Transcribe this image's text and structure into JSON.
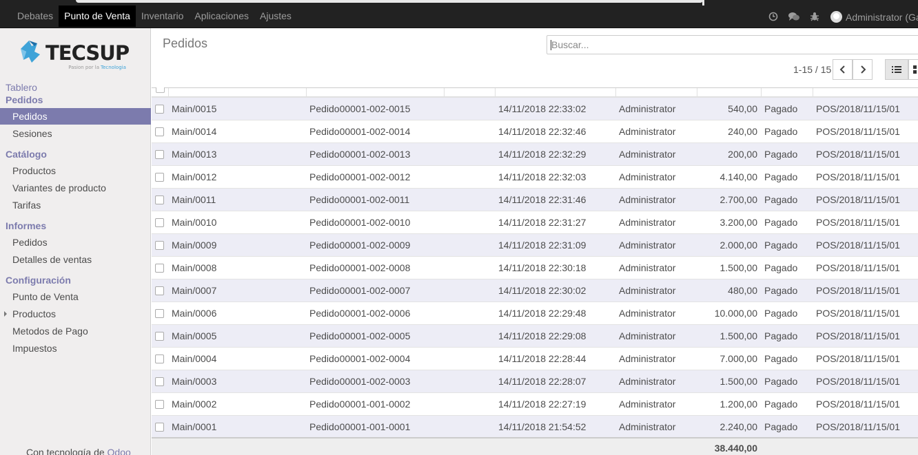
{
  "topbar": {
    "menu": [
      "Debates",
      "Punto de Venta",
      "Inventario",
      "Aplicaciones",
      "Ajustes"
    ],
    "user_label": "Administrator (Gab"
  },
  "sidebar": {
    "logo_text": "TECSUP",
    "logo_tagline_prefix": "Pasion por la",
    "logo_tagline_suffix": "Tecnologia",
    "tablero": "Tablero",
    "pedidos_header": "Pedidos",
    "pedidos_item": "Pedidos",
    "sesiones": "Sesiones",
    "catalogo": "Catálogo",
    "productos": "Productos",
    "variantes": "Variantes de producto",
    "tarifas": "Tarifas",
    "informes": "Informes",
    "inf_pedidos": "Pedidos",
    "detalles": "Detalles de ventas",
    "configuracion": "Configuración",
    "punto_venta": "Punto de Venta",
    "conf_productos": "Productos",
    "metodos": "Metodos de Pago",
    "impuestos": "Impuestos",
    "powered_prefix": "Con tecnología de",
    "powered_brand": "Odoo"
  },
  "control": {
    "title": "Pedidos",
    "search_placeholder": "Buscar...",
    "pager": "1-15 / 15"
  },
  "orders": [
    {
      "ref": "Main/0015",
      "order": "Pedido00001-002-0015",
      "date": "14/11/2018 22:33:02",
      "user": "Administrator",
      "amount": "540,00",
      "state": "Pagado",
      "session": "POS/2018/11/15/01"
    },
    {
      "ref": "Main/0014",
      "order": "Pedido00001-002-0014",
      "date": "14/11/2018 22:32:46",
      "user": "Administrator",
      "amount": "240,00",
      "state": "Pagado",
      "session": "POS/2018/11/15/01"
    },
    {
      "ref": "Main/0013",
      "order": "Pedido00001-002-0013",
      "date": "14/11/2018 22:32:29",
      "user": "Administrator",
      "amount": "200,00",
      "state": "Pagado",
      "session": "POS/2018/11/15/01"
    },
    {
      "ref": "Main/0012",
      "order": "Pedido00001-002-0012",
      "date": "14/11/2018 22:32:03",
      "user": "Administrator",
      "amount": "4.140,00",
      "state": "Pagado",
      "session": "POS/2018/11/15/01"
    },
    {
      "ref": "Main/0011",
      "order": "Pedido00001-002-0011",
      "date": "14/11/2018 22:31:46",
      "user": "Administrator",
      "amount": "2.700,00",
      "state": "Pagado",
      "session": "POS/2018/11/15/01"
    },
    {
      "ref": "Main/0010",
      "order": "Pedido00001-002-0010",
      "date": "14/11/2018 22:31:27",
      "user": "Administrator",
      "amount": "3.200,00",
      "state": "Pagado",
      "session": "POS/2018/11/15/01"
    },
    {
      "ref": "Main/0009",
      "order": "Pedido00001-002-0009",
      "date": "14/11/2018 22:31:09",
      "user": "Administrator",
      "amount": "2.000,00",
      "state": "Pagado",
      "session": "POS/2018/11/15/01"
    },
    {
      "ref": "Main/0008",
      "order": "Pedido00001-002-0008",
      "date": "14/11/2018 22:30:18",
      "user": "Administrator",
      "amount": "1.500,00",
      "state": "Pagado",
      "session": "POS/2018/11/15/01"
    },
    {
      "ref": "Main/0007",
      "order": "Pedido00001-002-0007",
      "date": "14/11/2018 22:30:02",
      "user": "Administrator",
      "amount": "480,00",
      "state": "Pagado",
      "session": "POS/2018/11/15/01"
    },
    {
      "ref": "Main/0006",
      "order": "Pedido00001-002-0006",
      "date": "14/11/2018 22:29:48",
      "user": "Administrator",
      "amount": "10.000,00",
      "state": "Pagado",
      "session": "POS/2018/11/15/01"
    },
    {
      "ref": "Main/0005",
      "order": "Pedido00001-002-0005",
      "date": "14/11/2018 22:29:08",
      "user": "Administrator",
      "amount": "1.500,00",
      "state": "Pagado",
      "session": "POS/2018/11/15/01"
    },
    {
      "ref": "Main/0004",
      "order": "Pedido00001-002-0004",
      "date": "14/11/2018 22:28:44",
      "user": "Administrator",
      "amount": "7.000,00",
      "state": "Pagado",
      "session": "POS/2018/11/15/01"
    },
    {
      "ref": "Main/0003",
      "order": "Pedido00001-002-0003",
      "date": "14/11/2018 22:28:07",
      "user": "Administrator",
      "amount": "1.500,00",
      "state": "Pagado",
      "session": "POS/2018/11/15/01"
    },
    {
      "ref": "Main/0002",
      "order": "Pedido00001-001-0002",
      "date": "14/11/2018 22:27:19",
      "user": "Administrator",
      "amount": "1.200,00",
      "state": "Pagado",
      "session": "POS/2018/11/15/01"
    },
    {
      "ref": "Main/0001",
      "order": "Pedido00001-001-0001",
      "date": "14/11/2018 21:54:52",
      "user": "Administrator",
      "amount": "2.240,00",
      "state": "Pagado",
      "session": "POS/2018/11/15/01"
    }
  ],
  "total": "38.440,00",
  "colors": {
    "accent": "#7c7bad",
    "topbar": "#222222",
    "sidebar": "#f0eeee",
    "row_alt": "#ededf6"
  },
  "icons": [
    "clock-icon",
    "chat-icon",
    "bug-icon",
    "avatar",
    "search-icon",
    "chevron-left-icon",
    "chevron-right-icon",
    "list-view-icon",
    "kanban-view-icon"
  ]
}
